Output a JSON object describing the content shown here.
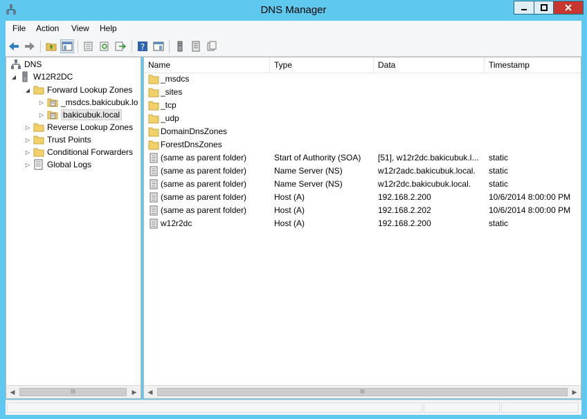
{
  "window": {
    "title": "DNS Manager"
  },
  "colors": {
    "titlebar": "#5fc8ee",
    "close_button": "#c7372f",
    "selection": "#e6e6e6"
  },
  "menu": [
    "File",
    "Action",
    "View",
    "Help"
  ],
  "toolbar": {
    "buttons": [
      "back-icon",
      "forward-icon",
      "up-folder-icon",
      "show-hide-console-tree-icon",
      "properties-icon",
      "refresh-icon",
      "export-list-icon",
      "help-icon",
      "show-hide-action-pane-icon",
      "server-icon",
      "zone-list-icon",
      "records-icon"
    ]
  },
  "tree": {
    "root": "DNS",
    "server": "W12R2DC",
    "forward": "Forward Lookup Zones",
    "msdcs_zone": "_msdcs.bakicubuk.lo",
    "local_zone": "bakicubuk.local",
    "reverse": "Reverse Lookup Zones",
    "trust": "Trust Points",
    "conditional": "Conditional Forwarders",
    "logs": "Global Logs"
  },
  "list": {
    "columns": {
      "name": "Name",
      "type": "Type",
      "data": "Data",
      "timestamp": "Timestamp"
    },
    "rows": [
      {
        "icon": "folder",
        "name": "_msdcs",
        "type": "",
        "data": "",
        "timestamp": ""
      },
      {
        "icon": "folder",
        "name": "_sites",
        "type": "",
        "data": "",
        "timestamp": ""
      },
      {
        "icon": "folder",
        "name": "_tcp",
        "type": "",
        "data": "",
        "timestamp": ""
      },
      {
        "icon": "folder",
        "name": "_udp",
        "type": "",
        "data": "",
        "timestamp": ""
      },
      {
        "icon": "folder",
        "name": "DomainDnsZones",
        "type": "",
        "data": "",
        "timestamp": ""
      },
      {
        "icon": "folder",
        "name": "ForestDnsZones",
        "type": "",
        "data": "",
        "timestamp": ""
      },
      {
        "icon": "record",
        "name": "(same as parent folder)",
        "type": "Start of Authority (SOA)",
        "data": "[51], w12r2dc.bakicubuk.l...",
        "timestamp": "static"
      },
      {
        "icon": "record",
        "name": "(same as parent folder)",
        "type": "Name Server (NS)",
        "data": "w12r2adc.bakicubuk.local.",
        "timestamp": "static"
      },
      {
        "icon": "record",
        "name": "(same as parent folder)",
        "type": "Name Server (NS)",
        "data": "w12r2dc.bakicubuk.local.",
        "timestamp": "static"
      },
      {
        "icon": "record",
        "name": "(same as parent folder)",
        "type": "Host (A)",
        "data": "192.168.2.200",
        "timestamp": "10/6/2014 8:00:00 PM"
      },
      {
        "icon": "record",
        "name": "(same as parent folder)",
        "type": "Host (A)",
        "data": "192.168.2.202",
        "timestamp": "10/6/2014 8:00:00 PM"
      },
      {
        "icon": "record",
        "name": "w12r2dc",
        "type": "Host (A)",
        "data": "192.168.2.200",
        "timestamp": "static"
      }
    ]
  },
  "scroll": {
    "thumb_glyph": "III"
  }
}
